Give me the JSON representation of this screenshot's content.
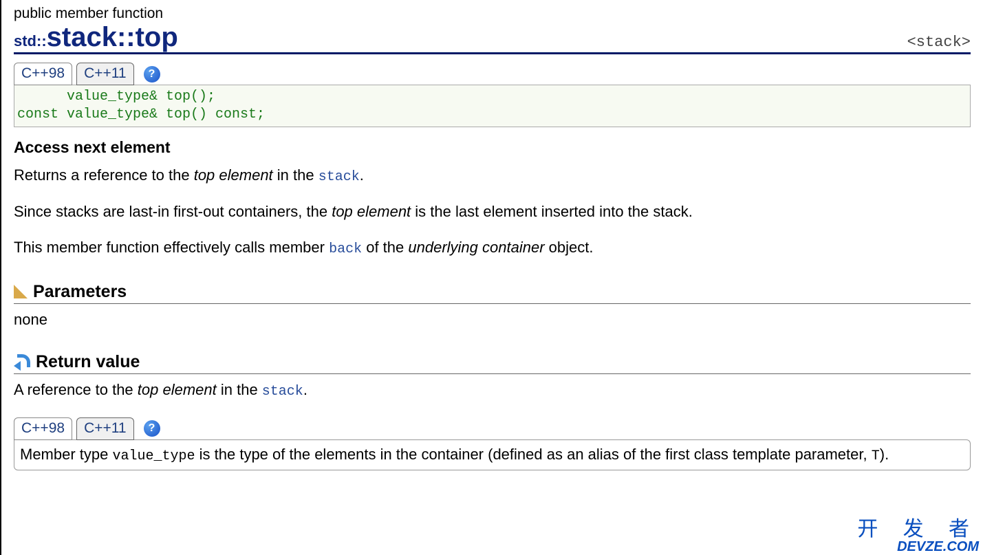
{
  "header": {
    "category": "public member function",
    "prefix": "std::",
    "className": "stack",
    "separator": "::",
    "member": "top",
    "include": "<stack>"
  },
  "tabs": {
    "items": [
      "C++98",
      "C++11"
    ],
    "help": "?"
  },
  "signature": "      value_type& top();\nconst value_type& top() const;",
  "brief": "Access next element",
  "desc": {
    "p1_a": "Returns a reference to the ",
    "p1_em": "top element",
    "p1_b": " in the ",
    "p1_link": "stack",
    "p1_c": ".",
    "p2_a": "Since stacks are last-in first-out containers, the ",
    "p2_em": "top element",
    "p2_b": " is the last element inserted into the stack.",
    "p3_a": "This member function effectively calls member ",
    "p3_link": "back",
    "p3_b": " of the ",
    "p3_em": "underlying container",
    "p3_c": " object."
  },
  "sections": {
    "parameters": {
      "title": "Parameters",
      "body": "none"
    },
    "returnValue": {
      "title": "Return value",
      "p_a": "A reference to the ",
      "p_em": "top element",
      "p_b": " in the ",
      "p_link": "stack",
      "p_c": ".",
      "box_a": "Member type ",
      "box_code1": "value_type",
      "box_b": " is the type of the elements in the container (defined as an alias of the first class template parameter, ",
      "box_code2": "T",
      "box_c": ")."
    }
  },
  "watermark": {
    "cn": "开 发 者",
    "en": "DEVZE.COM"
  }
}
